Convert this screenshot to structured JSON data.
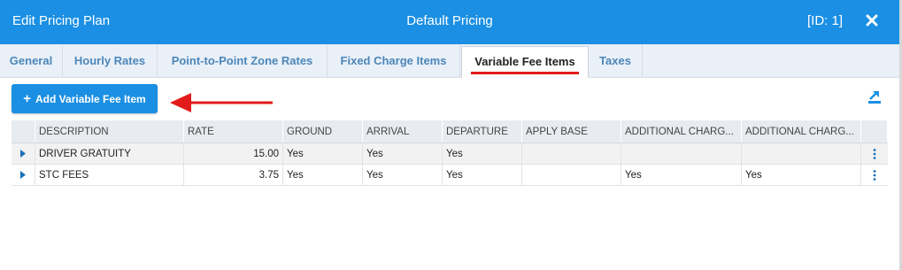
{
  "window": {
    "title": "Edit Pricing Plan",
    "plan_name": "Default Pricing",
    "plan_id": "[ID: 1]",
    "accent_color": "#1a8fe3"
  },
  "tabs": [
    {
      "label": "General"
    },
    {
      "label": "Hourly Rates"
    },
    {
      "label": "Point-to-Point Zone Rates"
    },
    {
      "label": "Fixed Charge Items"
    },
    {
      "label": "Variable Fee Items",
      "active": true
    },
    {
      "label": "Taxes"
    }
  ],
  "toolbar": {
    "add_label": "Add Variable Fee Item"
  },
  "grid": {
    "columns": [
      "DESCRIPTION",
      "RATE",
      "GROUND",
      "ARRIVAL",
      "DEPARTURE",
      "APPLY BASE",
      "ADDITIONAL CHARG...",
      "ADDITIONAL CHARG..."
    ],
    "rows": [
      [
        "DRIVER GRATUITY",
        "15.00",
        "Yes",
        "Yes",
        "Yes",
        "",
        "",
        ""
      ],
      [
        "STC FEES",
        "3.75",
        "Yes",
        "Yes",
        "Yes",
        "",
        "Yes",
        "Yes"
      ]
    ]
  }
}
